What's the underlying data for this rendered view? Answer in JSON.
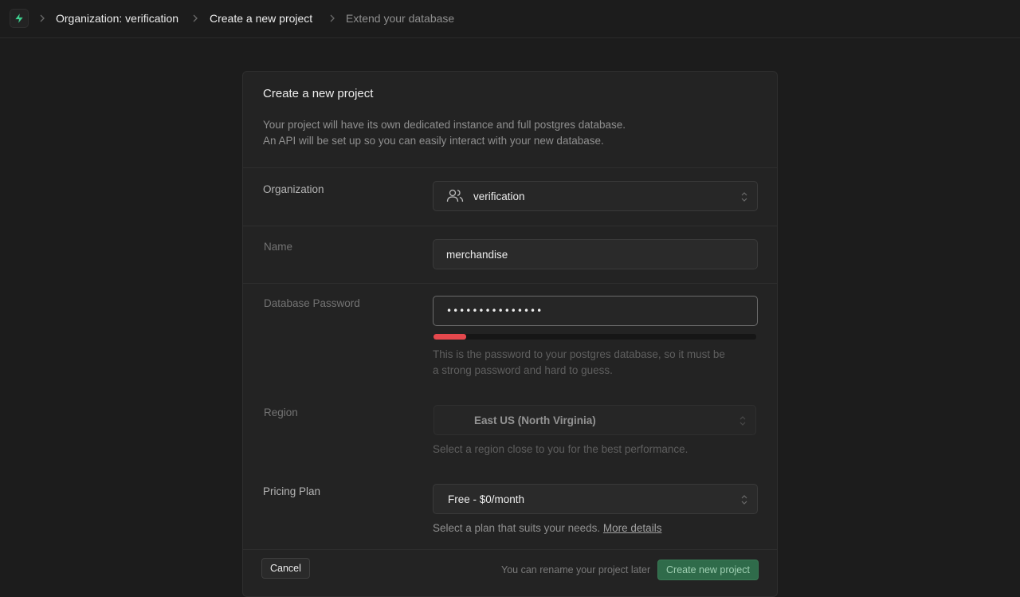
{
  "breadcrumb": {
    "items": [
      {
        "label": "Organization: verification"
      },
      {
        "label": "Create a new project"
      },
      {
        "label": "Extend your database"
      }
    ]
  },
  "card": {
    "title": "Create a new project",
    "description_line1": "Your project will have its own dedicated instance and full postgres database.",
    "description_line2": "An API will be set up so you can easily interact with your new database."
  },
  "organization": {
    "label": "Organization",
    "value": "verification"
  },
  "name": {
    "label": "Name",
    "value": "merchandise"
  },
  "password": {
    "label": "Database Password",
    "value": "•••••••••••••••",
    "strength_fraction": 0.1,
    "helper_line1": "This is the password to your postgres database, so it must be",
    "helper_line2": "a strong password and hard to guess."
  },
  "region": {
    "label": "Region",
    "value": "East US (North Virginia)",
    "helper": "Select a region close to you for the best performance."
  },
  "pricing": {
    "label": "Pricing Plan",
    "value": "Free - $0/month",
    "helper": "Select a plan that suits your needs.",
    "link": "More details"
  },
  "footer": {
    "cancel_label": "Cancel",
    "note": "You can rename your project later",
    "create_label": "Create new project"
  },
  "colors": {
    "brand": "#3ecf8e",
    "danger": "#e5484d"
  }
}
